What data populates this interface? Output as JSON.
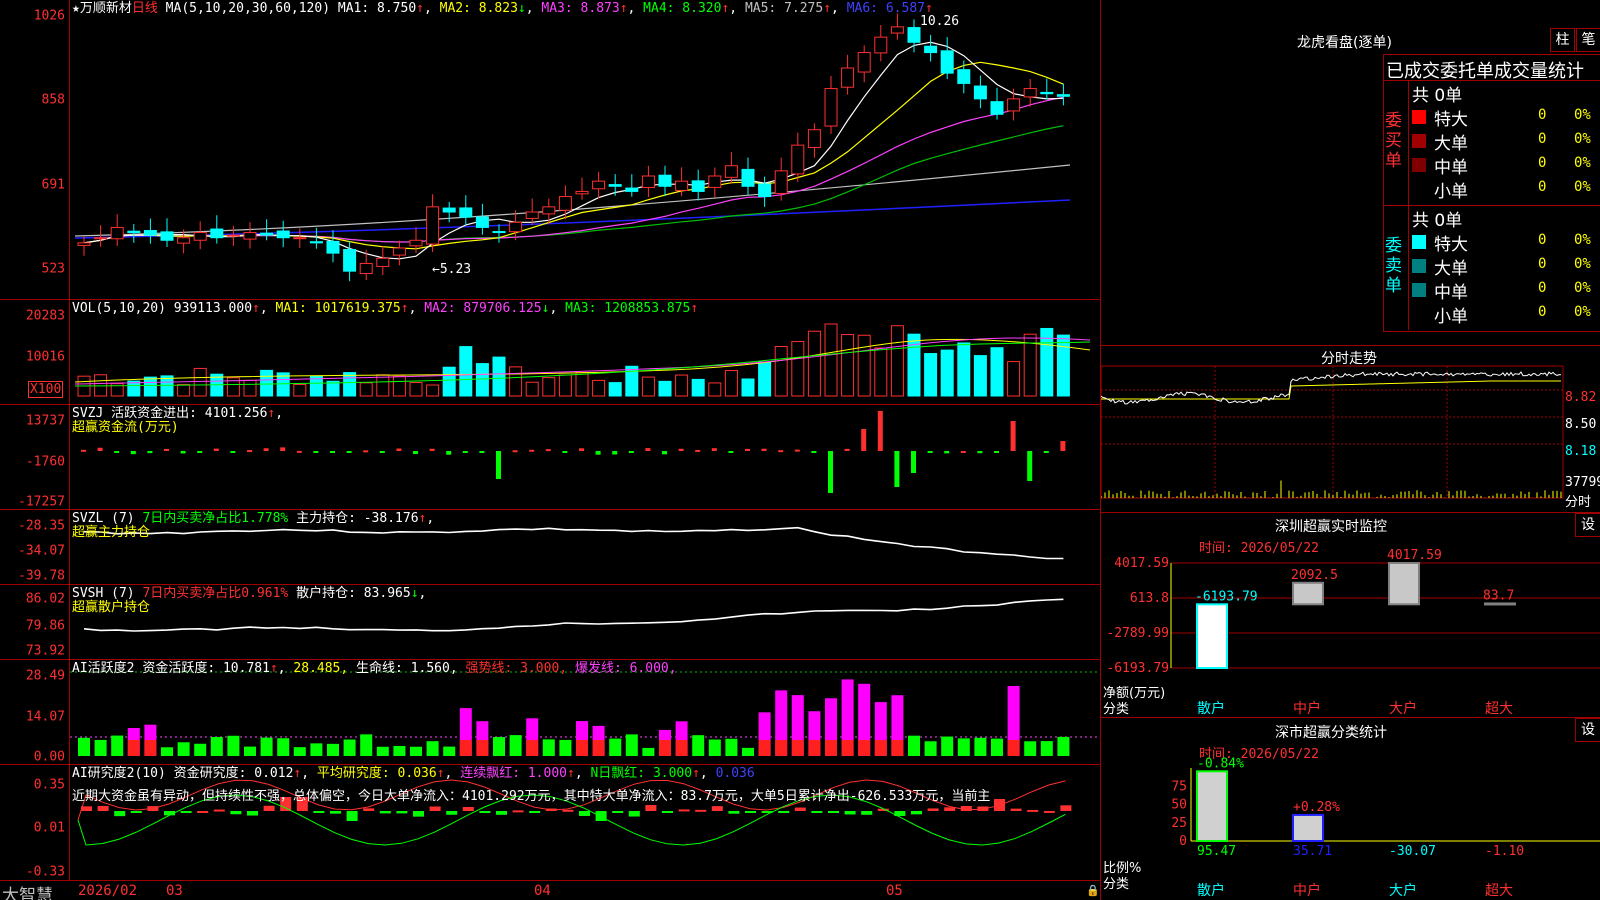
{
  "main": {
    "title": "★万顺新材",
    "period": "日线",
    "ma_label": "MA(5,10,20,30,60,120)",
    "ma1": "MA1: 8.750",
    "ma2": "MA2: 8.823",
    "ma3": "MA3: 8.873",
    "ma4": "MA4: 8.320",
    "ma5": "MA5: 7.275",
    "ma6": "MA6: 6.587",
    "high_note": "10.26",
    "low_note": "←5.23",
    "yticks": [
      "1026",
      "858",
      "691",
      "523"
    ]
  },
  "vol": {
    "label": "VOL(5,10,20)",
    "value": "939113.000",
    "ma1": "MA1: 1017619.375",
    "ma2": "MA2: 879706.125",
    "ma3": "MA3: 1208853.875",
    "yticks": [
      "20283",
      "10016"
    ],
    "unit": "X100"
  },
  "svzj": {
    "label": "SVZJ",
    "text": "活跃资金进出: 4101.256",
    "sub": "超赢资金流(万元)",
    "yticks": [
      "13737",
      "-1760",
      "-17257"
    ]
  },
  "svzl": {
    "label": "SVZL (7)",
    "a": "7日内买卖净占比1.778%",
    "b": "主力持仓: -38.176",
    "sub": "超赢主力持仓",
    "yticks": [
      "-28.35",
      "-34.07",
      "-39.78"
    ]
  },
  "svsh": {
    "label": "SVSH (7)",
    "a": "7日内买卖净占比0.961%",
    "b": "散户持仓: 83.965",
    "sub": "超赢散户持仓",
    "yticks": [
      "86.02",
      "79.86",
      "73.92"
    ]
  },
  "ai1": {
    "label": "AI活跃度2",
    "a": "资金活跃度: 10.781",
    "b": "28.485,",
    "c": "生命线: 1.560,",
    "d": "强势线: 3.000,",
    "e": "爆发线: 6.000,",
    "yticks": [
      "28.49",
      "14.07",
      "0.00"
    ]
  },
  "ai2": {
    "label": "AI研究度2(10)",
    "a": "资金研究度: 0.012",
    "b": "平均研究度: 0.036",
    "c": "连续飘红: 1.000",
    "d": "N日飘红: 3.000",
    "e": "0.036",
    "note": "近期大资金虽有异动，但持续性不强，总体偏空，今日大单净流入：4101.292万元，其中特大单净流入：83.7万元，大单5日累计净出-626.533万元，当前主",
    "yticks": [
      "0.35",
      "0.01",
      "-0.33"
    ]
  },
  "timeaxis": {
    "brand": "大智慧",
    "labels": [
      "2026/02",
      "03",
      "04",
      "05"
    ]
  },
  "dragon": {
    "title": "龙虎看盘(逐单)",
    "btn_bar": "柱",
    "btn_pen": "笔",
    "tabs": "已成交委托单成交量统计",
    "buy_side": "委买单",
    "sell_side": "委卖单",
    "buy_total": "共 0单",
    "sell_total": "共 0单",
    "rows": [
      {
        "name": "特大",
        "count": "0",
        "pct": "0%"
      },
      {
        "name": "大单",
        "count": "0",
        "pct": "0%"
      },
      {
        "name": "中单",
        "count": "0",
        "pct": "0%"
      },
      {
        "name": "小单",
        "count": "0",
        "pct": "0%"
      }
    ],
    "buy_colors": [
      "#ff0000",
      "#a00000",
      "#800000",
      "#000000"
    ],
    "sell_colors": [
      "#00ffff",
      "#008080",
      "#008080",
      "#000000"
    ]
  },
  "fenshi": {
    "title": "分时走势",
    "yticks": [
      "8.82",
      "8.50",
      "8.18"
    ],
    "vol_tick": "37799",
    "vol_unit": "分时"
  },
  "monitor": {
    "title": "深圳超赢实时监控",
    "btn": "设",
    "date": "时间: 2026/05/22",
    "yticks": [
      "4017.59",
      "613.8",
      "-2789.99",
      "-6193.79"
    ],
    "ylabel": "净额(万元)",
    "xlabel": "分类",
    "bars": [
      {
        "cat": "散户",
        "value": -6193.79,
        "label": "-6193.79"
      },
      {
        "cat": "中户",
        "value": 2092.5,
        "label": "2092.5"
      },
      {
        "cat": "大户",
        "value": 4017.59,
        "label": "4017.59"
      },
      {
        "cat": "超大",
        "value": 83.7,
        "label": "83.7"
      }
    ]
  },
  "classify": {
    "title": "深市超赢分类统计",
    "btn": "设",
    "date": "时间: 2026/05/22",
    "yticks": [
      "75",
      "50",
      "25",
      "0"
    ],
    "ylabel": "比例%",
    "xlabel": "分类",
    "bars": [
      {
        "cat": "散户",
        "top": "-0.84%",
        "value": 95.47,
        "label": "95.47"
      },
      {
        "cat": "中户",
        "top": "+0.28%",
        "value": 35.71,
        "label": "35.71"
      },
      {
        "cat": "大户",
        "top": "",
        "value": -30.07,
        "label": "-30.07"
      },
      {
        "cat": "超大",
        "top": "",
        "value": -1.1,
        "label": "-1.10"
      }
    ]
  },
  "colors": {
    "up": "#ff3030",
    "down": "#00ffff",
    "grid": "#a00000",
    "green": "#00ff00",
    "magenta": "#ff00ff"
  }
}
